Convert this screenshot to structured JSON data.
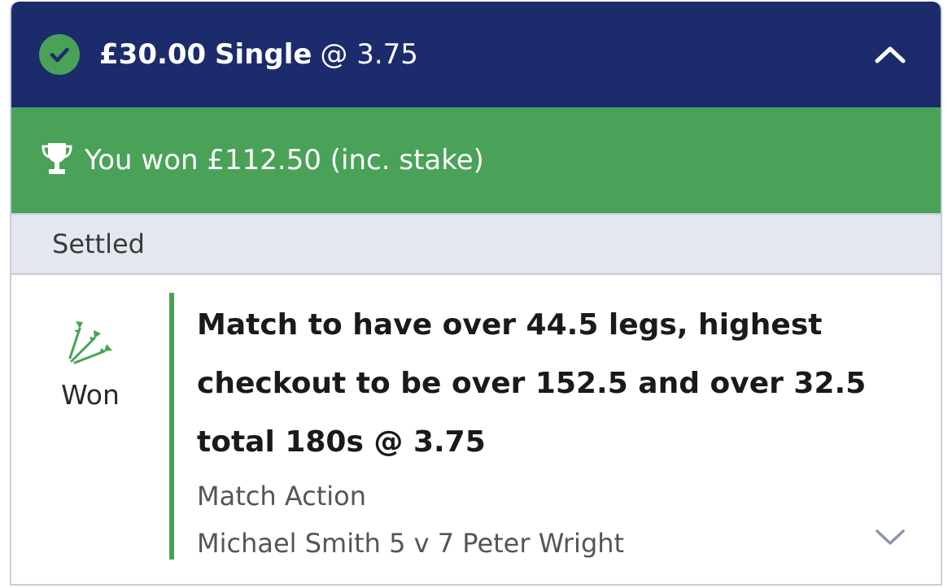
{
  "bet": {
    "stake": "£30.00",
    "type": "Single",
    "odds_text": "@ 3.75",
    "status_icon": "check-circle-icon",
    "collapse_icon": "chevron-up-icon"
  },
  "banner": {
    "icon": "trophy-icon",
    "text": "You won £112.50 (inc. stake)"
  },
  "status": {
    "label": "Settled"
  },
  "selection": {
    "sport_icon": "darts-icon",
    "result": "Won",
    "market": "Match to have over 44.5 legs, highest checkout to be over 152.5 and over 32.5 total 180s @ 3.75",
    "market_type": "Match Action",
    "event": "Michael Smith 5 v 7 Peter Wright",
    "expand_icon": "chevron-down-icon"
  },
  "colors": {
    "header_bg": "#1c2b6b",
    "success_green": "#4aa258",
    "status_bar_bg": "#e4e7ef"
  }
}
